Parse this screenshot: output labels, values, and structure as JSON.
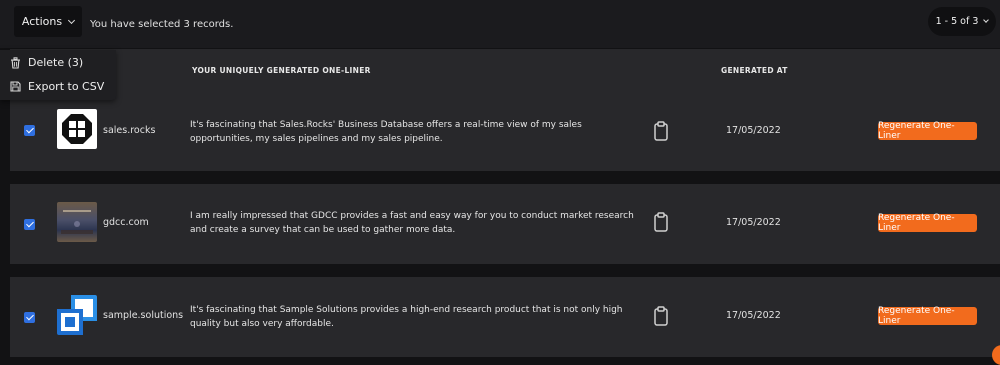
{
  "toolbar": {
    "actions_label": "Actions",
    "selection_text": "You have selected 3 records.",
    "pagination_label": "1 - 5 of 3"
  },
  "actions_menu": {
    "items": [
      {
        "label": "Delete (3)",
        "icon": "trash-icon"
      },
      {
        "label": "Export to CSV",
        "icon": "save-icon"
      }
    ]
  },
  "table": {
    "columns": [
      "YOUR UNIQUELY GENERATED ONE-LINER",
      "GENERATED AT"
    ],
    "rows": [
      {
        "checked": true,
        "domain": "sales.rocks",
        "one_liner": "It's fascinating that Sales.Rocks' Business Database offers a real-time view of my sales opportunities, my sales pipelines and my sales pipeline.",
        "generated_at": "17/05/2022",
        "action_label": "Regenerate One-Liner"
      },
      {
        "checked": true,
        "domain": "gdcc.com",
        "one_liner": "I am really impressed that GDCC provides a fast and easy way for you to conduct market research and create a survey that can be used to gather more data.",
        "generated_at": "17/05/2022",
        "action_label": "Regenerate One-Liner"
      },
      {
        "checked": true,
        "domain": "sample.solutions",
        "one_liner": "It's fascinating that Sample Solutions provides a high-end research product that is not only high quality but also very affordable.",
        "generated_at": "17/05/2022",
        "action_label": "Regenerate One-Liner"
      }
    ]
  },
  "colors": {
    "accent": "#f26b1d",
    "checkbox": "#2f6fe0",
    "row_background": "#28282b"
  }
}
